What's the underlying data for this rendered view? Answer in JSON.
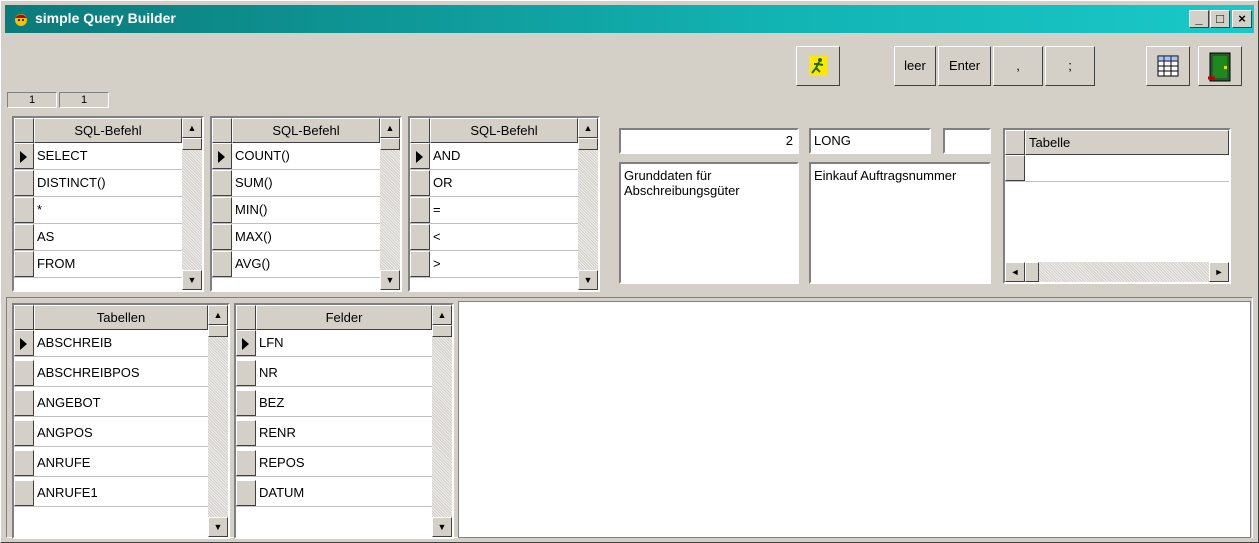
{
  "window": {
    "title": "simple Query Builder",
    "controls": {
      "minimize": "_",
      "maximize": "□",
      "close": "×"
    }
  },
  "toolbar": {
    "run_icon": "running-man-icon",
    "buttons": {
      "leer": "leer",
      "enter": "Enter",
      "comma": ",",
      "semicolon": ";"
    },
    "grid_icon": "table-grid-icon",
    "exit_icon": "exit-door-icon"
  },
  "status": {
    "cell1": "1",
    "cell2": "1"
  },
  "sql_grids": [
    {
      "header": "SQL-Befehl",
      "rows": [
        "SELECT",
        "DISTINCT()",
        "*",
        "AS",
        "FROM"
      ]
    },
    {
      "header": "SQL-Befehl",
      "rows": [
        "COUNT()",
        "SUM()",
        "MIN()",
        "MAX()",
        "AVG()"
      ]
    },
    {
      "header": "SQL-Befehl",
      "rows": [
        "AND",
        "OR",
        "=",
        "<",
        ">"
      ]
    }
  ],
  "fields": {
    "number": "2",
    "type": "LONG",
    "empty": "",
    "memo1": "Grunddaten für Abschreibungsgüter",
    "memo2": "Einkauf Auftragsnummer"
  },
  "tabelle_grid": {
    "header": "Tabelle",
    "rows": [
      ""
    ]
  },
  "tabellen_grid": {
    "header": "Tabellen",
    "rows": [
      "ABSCHREIB",
      "ABSCHREIBPOS",
      "ANGEBOT",
      "ANGPOS",
      "ANRUFE",
      "ANRUFE1"
    ]
  },
  "felder_grid": {
    "header": "Felder",
    "rows": [
      "LFN",
      "NR",
      "BEZ",
      "RENR",
      "REPOS",
      "DATUM"
    ]
  },
  "query_text": ""
}
